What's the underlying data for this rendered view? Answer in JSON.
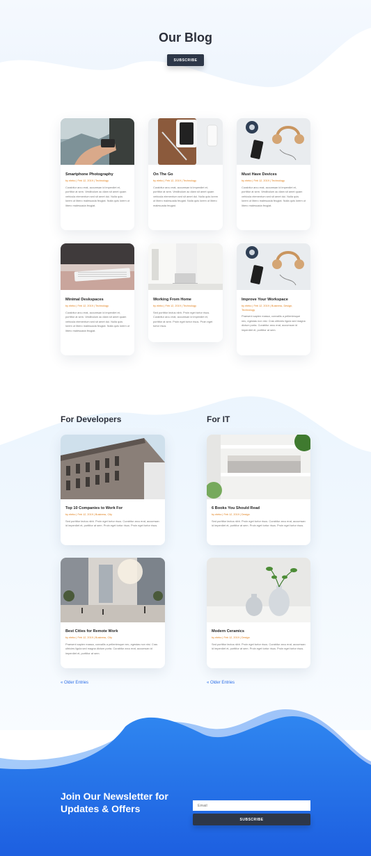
{
  "hero": {
    "title": "Our Blog",
    "subscribe_label": "SUBSCRIBE"
  },
  "posts": [
    {
      "title": "Smartphone Photography",
      "meta": "by elebo | Feb 12, 2019 | Technology",
      "excerpt": "Curabitur arcu erat, accumsan id imperdiet et, porttitor at sem. Vestibulum ac diam sit amet quam vehicula elementum sed sit amet dui. Nulla quis lorem ut libero malesuada feugiat. Nulla quis lorem ut libero malesuada feugiat."
    },
    {
      "title": "On The Go",
      "meta": "by elebo | Feb 12, 2019 | Technology",
      "excerpt": "Curabitur arcu erat, accumsan id imperdiet et, porttitor at sem. Vestibulum ac diam sit amet quam vehicula elementum sed sit amet dui. Nulla quis lorem ut libero malesuada feugiat. Nulla quis lorem ut libero malesuada feugiat."
    },
    {
      "title": "Must Have Devices",
      "meta": "by elebo | Feb 12, 2019 | Technology",
      "excerpt": "Curabitur arcu erat, accumsan id imperdiet et, porttitor at sem. Vestibulum ac diam sit amet quam vehicula elementum sed sit amet dui. Nulla quis lorem ut libero malesuada feugiat. Nulla quis lorem ut libero malesuada feugiat."
    },
    {
      "title": "Minimal Deskspaces",
      "meta": "by elebo | Feb 12, 2019 | Technology",
      "excerpt": "Curabitur arcu erat, accumsan id imperdiet et, porttitor at sem. Vestibulum ac diam sit amet quam vehicula elementum sed sit amet dui. Nulla quis lorem ut libero malesuada feugiat. Nulla quis lorem ut libero malesuada feugiat."
    },
    {
      "title": "Working From Home",
      "meta": "by elebo | Feb 12, 2019 | Technology",
      "excerpt": "Sed porttitor lectus nibh. Proin eget tortor risus. Curabitur arcu erat, accumsan id imperdiet et, porttitor at sem. Proin eget tortor risus. Proin eget tortor risus."
    },
    {
      "title": "Improve Your Workspace",
      "meta": "by elebo | Feb 12, 2019 | Business, Design, Technology",
      "excerpt": "Praesent sapien massa, convallis a pellentesque nec, egestas non nisi. Cras ultricies ligula sed magna dictum porta. Curabitur arcu erat, accumsan id imperdiet et, porttitor at sem."
    }
  ],
  "developers": {
    "title": "For Developers",
    "posts": [
      {
        "title": "Top 10 Companies to Work For",
        "meta": "by elebo | Feb 12, 2019 | Business, City",
        "excerpt": "Sed porttitor lectus nibh. Proin eget tortor risus. Curabitur arcu erat, accumsan id imperdiet et, porttitor at sem. Proin eget tortor risus. Proin eget tortor risus."
      },
      {
        "title": "Best Cities for Remote Work",
        "meta": "by elebo | Feb 12, 2019 | Business, City",
        "excerpt": "Praesent sapien massa, convallis a pellentesque nec, egestas non nisi. Cras ultricies ligula sed magna dictum porta. Curabitur arcu erat, accumsan id imperdiet et, porttitor at sem."
      }
    ],
    "older": "« Older Entries"
  },
  "it": {
    "title": "For IT",
    "posts": [
      {
        "title": "6 Books You Should Read",
        "meta": "by elebo | Feb 12, 2019 | Design",
        "excerpt": "Sed porttitor lectus nibh. Proin eget tortor risus. Curabitur arcu erat, accumsan id imperdiet et, porttitor at sem. Proin eget tortor risus. Proin eget tortor risus."
      },
      {
        "title": "Modern Ceramics",
        "meta": "by elebo | Feb 12, 2019 | Design",
        "excerpt": "Sed porttitor lectus nibh. Proin eget tortor risus. Curabitur arcu erat, accumsan id imperdiet et, porttitor at sem. Proin eget tortor risus. Proin eget tortor risus."
      }
    ],
    "older": "« Older Entries"
  },
  "newsletter": {
    "title": "Join Our Newsletter for Updates & Offers",
    "email_placeholder": "Email",
    "subscribe_label": "SUBSCRIBE"
  },
  "colors": {
    "accent": "#2b6ee8",
    "dark_button": "#2d3748",
    "meta": "#e0801e",
    "wave_blue": "#3b82f6"
  },
  "icons": [
    "hand-phone-photo",
    "tablet-phone-flatlay",
    "headphones-devices",
    "keyboard-desk",
    "home-office-laptop",
    "building-facade",
    "bookshelf",
    "city-street",
    "ceramic-vases"
  ]
}
